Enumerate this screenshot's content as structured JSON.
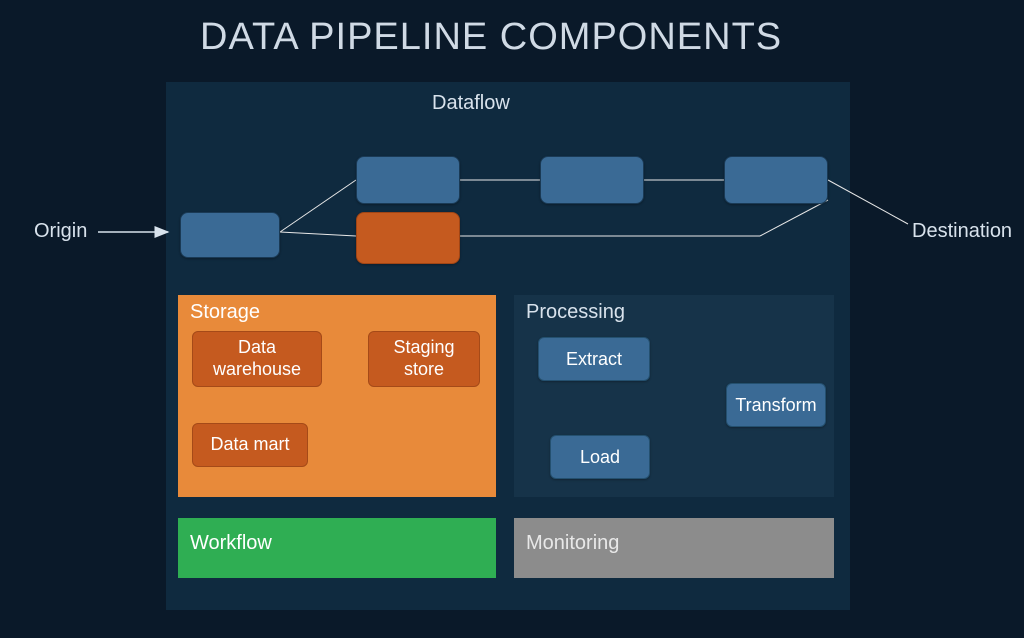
{
  "title": "DATA PIPELINE COMPONENTS",
  "origin_label": "Origin",
  "destination_label": "Destination",
  "dataflow": {
    "label": "Dataflow"
  },
  "storage": {
    "title": "Storage",
    "data_warehouse": "Data warehouse",
    "staging_store": "Staging store",
    "data_mart": "Data mart"
  },
  "processing": {
    "title": "Processing",
    "extract": "Extract",
    "transform": "Transform",
    "load": "Load"
  },
  "workflow": {
    "title": "Workflow"
  },
  "monitoring": {
    "title": "Monitoring"
  },
  "colors": {
    "bg": "#0a1929",
    "panel": "#0f2a3f",
    "node_blue": "#3a6a95",
    "node_orange": "#c55a1f",
    "storage_bg": "#e88a3a",
    "processing_bg": "#163349",
    "workflow_bg": "#2fae53",
    "monitoring_bg": "#8c8c8c"
  }
}
